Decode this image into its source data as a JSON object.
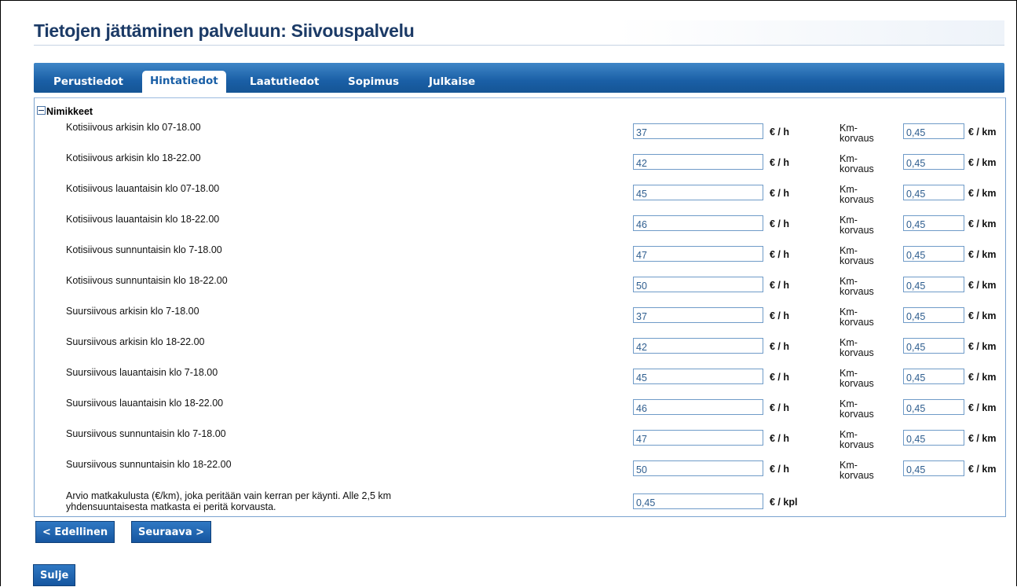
{
  "page": {
    "title": "Tietojen jättäminen palveluun: Siivouspalvelu"
  },
  "tabs": [
    {
      "label": "Perustiedot"
    },
    {
      "label": "Hintatiedot"
    },
    {
      "label": "Laatutiedot"
    },
    {
      "label": "Sopimus"
    },
    {
      "label": "Julkaise"
    }
  ],
  "active_tab": "Hintatiedot",
  "section": {
    "title": "Nimikkeet"
  },
  "rows": [
    {
      "label": "Kotisiivous arkisin klo 07-18.00",
      "price": "37",
      "unit": "€ / h",
      "km_label": "Km-korvaus",
      "km": "0,45",
      "km_unit": "€ / km"
    },
    {
      "label": "Kotisiivous arkisin klo 18-22.00",
      "price": "42",
      "unit": "€ / h",
      "km_label": "Km-korvaus",
      "km": "0,45",
      "km_unit": "€ / km"
    },
    {
      "label": "Kotisiivous lauantaisin klo 07-18.00",
      "price": "45",
      "unit": "€ / h",
      "km_label": "Km-korvaus",
      "km": "0,45",
      "km_unit": "€ / km"
    },
    {
      "label": "Kotisiivous lauantaisin klo 18-22.00",
      "price": "46",
      "unit": "€ / h",
      "km_label": "Km-korvaus",
      "km": "0,45",
      "km_unit": "€ / km"
    },
    {
      "label": "Kotisiivous sunnuntaisin klo 7-18.00",
      "price": "47",
      "unit": "€ / h",
      "km_label": "Km-korvaus",
      "km": "0,45",
      "km_unit": "€ / km"
    },
    {
      "label": "Kotisiivous sunnuntaisin klo 18-22.00",
      "price": "50",
      "unit": "€ / h",
      "km_label": "Km-korvaus",
      "km": "0,45",
      "km_unit": "€ / km"
    },
    {
      "label": "Suursiivous arkisin klo 7-18.00",
      "price": "37",
      "unit": "€ / h",
      "km_label": "Km-korvaus",
      "km": "0,45",
      "km_unit": "€ / km"
    },
    {
      "label": "Suursiivous arkisin klo 18-22.00",
      "price": "42",
      "unit": "€ / h",
      "km_label": "Km-korvaus",
      "km": "0,45",
      "km_unit": "€ / km"
    },
    {
      "label": "Suursiivous lauantaisin klo 7-18.00",
      "price": "45",
      "unit": "€ / h",
      "km_label": "Km-korvaus",
      "km": "0,45",
      "km_unit": "€ / km"
    },
    {
      "label": "Suursiivous lauantaisin klo 18-22.00",
      "price": "46",
      "unit": "€ / h",
      "km_label": "Km-korvaus",
      "km": "0,45",
      "km_unit": "€ / km"
    },
    {
      "label": "Suursiivous sunnuntaisin klo 7-18.00",
      "price": "47",
      "unit": "€ / h",
      "km_label": "Km-korvaus",
      "km": "0,45",
      "km_unit": "€ / km"
    },
    {
      "label": "Suursiivous sunnuntaisin klo 18-22.00",
      "price": "50",
      "unit": "€ / h",
      "km_label": "Km-korvaus",
      "km": "0,45",
      "km_unit": "€ / km"
    }
  ],
  "travel": {
    "label": "Arvio matkakulusta (€/km), joka peritään vain kerran per käynti. Alle 2,5 km yhdensuuntaisesta matkasta ei peritä korvausta.",
    "value": "0,45",
    "unit": "€ / kpl"
  },
  "buttons": {
    "prev": "< Edellinen",
    "next": "Seuraava >",
    "close": "Sulje"
  },
  "colors": {
    "tab_bar": "#1a5fa6",
    "title": "#1b3a66",
    "input_border": "#6f9bc8"
  }
}
